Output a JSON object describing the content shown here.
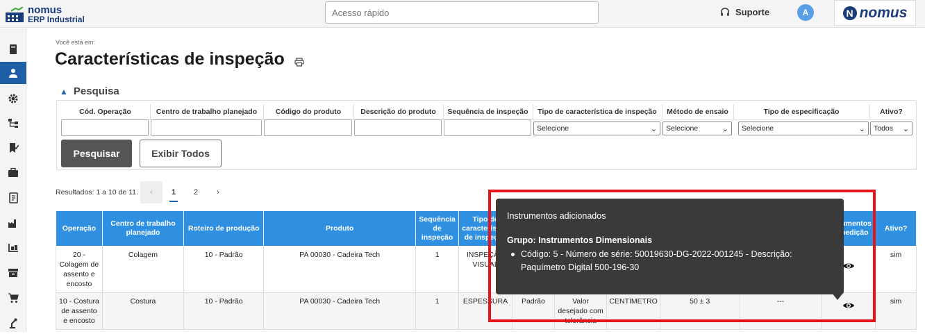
{
  "app": {
    "logo_line1": "nomus",
    "logo_line2": "ERP Industrial",
    "brand": "nomus",
    "brand_initial": "N"
  },
  "header": {
    "quick_access_placeholder": "Acesso rápido",
    "support_label": "Suporte",
    "user_initial": "A"
  },
  "sidebar": {
    "items": [
      "book-icon",
      "user-icon",
      "gear-icon",
      "flow-icon",
      "bookmark-check-icon",
      "briefcase-icon",
      "ledger-icon",
      "factory-icon",
      "forklift-icon",
      "archive-icon",
      "cart-icon",
      "robot-arm-icon"
    ],
    "active_index": 1
  },
  "page": {
    "breadcrumb": "Você está em:",
    "title": "Características de inspeção"
  },
  "search": {
    "heading": "Pesquisa",
    "fields": [
      {
        "label": "Cód. Operação"
      },
      {
        "label": "Centro de trabalho planejado"
      },
      {
        "label": "Código do produto"
      },
      {
        "label": "Descrição do produto"
      },
      {
        "label": "Sequência de inspeção"
      },
      {
        "label": "Tipo de característica de inspeção",
        "value": "Selecione"
      },
      {
        "label": "Método de ensaio",
        "value": "Selecione"
      },
      {
        "label": "Tipo de especificação",
        "value": "Selecione"
      },
      {
        "label": "Ativo?",
        "value": "Todos"
      }
    ],
    "search_button": "Pesquisar",
    "show_all_button": "Exibir Todos"
  },
  "pagination": {
    "results_text": "Resultados: 1 a 10 de 11.",
    "prev": "‹",
    "pages": [
      "1",
      "2"
    ],
    "current": "1",
    "next": "›"
  },
  "table": {
    "headers": [
      "Operação",
      "Centro de trabalho planejado",
      "Roteiro de produção",
      "Produto",
      "Sequência de inspeção",
      "Tipo de característica de inspeção",
      "",
      "",
      "",
      "",
      "",
      "Instrumentos de medição",
      "Ativo?"
    ],
    "rows": [
      {
        "operacao": "20 - Colagem de assento e encosto",
        "centro": "Colagem",
        "roteiro": "10 - Padrão",
        "produto": "PA 00030 - Cadeira Tech",
        "sequencia": "1",
        "tipo": "INSPEÇÃO VISUAL",
        "metodo": "",
        "especificacao": "",
        "unidade": "",
        "valor": "",
        "tolerancia": "",
        "ativo": "sim"
      },
      {
        "operacao": "10 - Costura de assento e encosto",
        "centro": "Costura",
        "roteiro": "10 - Padrão",
        "produto": "PA 00030 - Cadeira Tech",
        "sequencia": "1",
        "tipo": "ESPESSURA",
        "metodo": "Padrão",
        "especificacao": "Valor desejado com tolerância",
        "unidade": "CENTIMETRO",
        "valor": "50 ± 3",
        "tolerancia": "---",
        "ativo": "sim"
      }
    ]
  },
  "tooltip": {
    "title": "Instrumentos adicionados",
    "group": "Grupo: Instrumentos Dimensionais",
    "item": "Código: 5 - Número de série: 50019630-DG-2022-001245 - Descrição: Paquímetro Digital 500-196-30"
  },
  "colors": {
    "accent": "#2f8fe0",
    "sidebar_active": "#1f5fa8",
    "tooltip_bg": "#3a3a3a",
    "highlight": "#e8141c"
  }
}
